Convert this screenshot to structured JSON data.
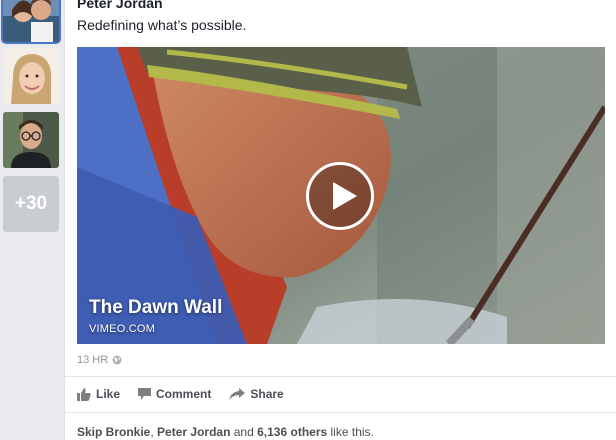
{
  "post": {
    "author": "Peter Jordan",
    "text": "Redefining what’s possible.",
    "timestamp": "13 HR"
  },
  "rail": {
    "more_count": "+30"
  },
  "video": {
    "title": "The Dawn Wall",
    "source": "VIMEO.COM"
  },
  "actions": {
    "like": "Like",
    "comment": "Comment",
    "share": "Share"
  },
  "likes": {
    "name1": "Skip Bronkie",
    "sep": ",",
    "name2": "Peter Jordan",
    "and": "and",
    "others": "6,136 others",
    "suffix": "like this."
  },
  "colors": {
    "accent": "#4a76c7",
    "text": "#1d2129",
    "muted": "#90949c"
  }
}
